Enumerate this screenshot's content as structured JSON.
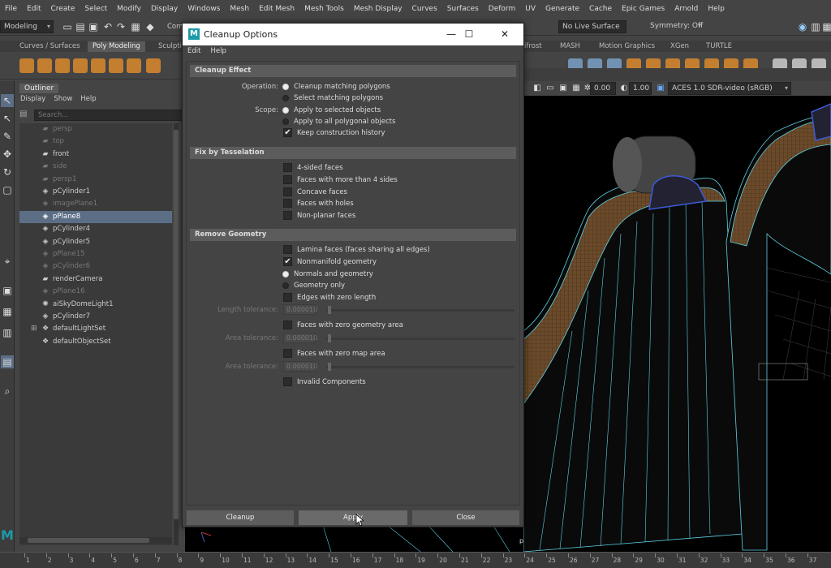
{
  "menubar": {
    "items": [
      "File",
      "Edit",
      "Create",
      "Select",
      "Modify",
      "Display",
      "Windows",
      "Mesh",
      "Edit Mesh",
      "Mesh Tools",
      "Mesh Display",
      "Curves",
      "Surfaces",
      "Deform",
      "UV",
      "Generate",
      "Cache",
      "Epic Games",
      "Arnold",
      "Help"
    ]
  },
  "status_line": {
    "mode": "Modeling",
    "component_label": "Com",
    "live_surface": "No Live Surface",
    "symmetry": "Symmetry: Off"
  },
  "shelf": {
    "tabs": [
      "Curves / Surfaces",
      "Poly Modeling",
      "Sculptin",
      "ifrost",
      "MASH",
      "Motion Graphics",
      "XGen",
      "TURTLE"
    ],
    "active_tab": "Poly Modeling"
  },
  "outliner": {
    "title": "Outliner",
    "menus": [
      "Display",
      "Show",
      "Help"
    ],
    "search_placeholder": "Search...",
    "rows": [
      {
        "label": "persp",
        "icon": "camera-icon",
        "dim": true
      },
      {
        "label": "top",
        "icon": "camera-icon",
        "dim": true
      },
      {
        "label": "front",
        "icon": "camera-icon",
        "dim": false
      },
      {
        "label": "side",
        "icon": "camera-icon",
        "dim": true
      },
      {
        "label": "persp1",
        "icon": "camera-icon",
        "dim": true
      },
      {
        "label": "pCylinder1",
        "icon": "mesh-icon",
        "dim": false
      },
      {
        "label": "imagePlane1",
        "icon": "mesh-icon",
        "dim": true
      },
      {
        "label": "pPlane8",
        "icon": "mesh-icon",
        "dim": false,
        "selected": true
      },
      {
        "label": "pCylinder4",
        "icon": "mesh-icon",
        "dim": false
      },
      {
        "label": "pCylinder5",
        "icon": "mesh-icon",
        "dim": false
      },
      {
        "label": "pPlane15",
        "icon": "mesh-icon",
        "dim": true
      },
      {
        "label": "pCylinder6",
        "icon": "mesh-icon",
        "dim": true
      },
      {
        "label": "renderCamera",
        "icon": "camera-icon",
        "dim": false
      },
      {
        "label": "pPlane16",
        "icon": "mesh-icon",
        "dim": true
      },
      {
        "label": "aiSkyDomeLight1",
        "icon": "light-icon",
        "dim": false
      },
      {
        "label": "pCylinder7",
        "icon": "mesh-icon",
        "dim": false
      },
      {
        "label": "defaultLightSet",
        "icon": "set-icon",
        "dim": false,
        "expandable": true
      },
      {
        "label": "defaultObjectSet",
        "icon": "set-icon",
        "dim": false
      }
    ]
  },
  "viewport": {
    "near_value": "0.00",
    "far_value": "1.00",
    "color_space": "ACES 1.0 SDR-video (sRGB)",
    "camera_label": "persp"
  },
  "dialog": {
    "title": "Cleanup Options",
    "logo_letter": "M",
    "menus": [
      "Edit",
      "Help"
    ],
    "sections": {
      "cleanup_effect": "Cleanup Effect",
      "fix_by_tesselation": "Fix by Tesselation",
      "remove_geometry": "Remove Geometry"
    },
    "operation_label": "Operation:",
    "operation_options": [
      "Cleanup matching polygons",
      "Select matching polygons"
    ],
    "scope_label": "Scope:",
    "scope_options": [
      "Apply to selected objects",
      "Apply to all polygonal objects"
    ],
    "keep_history": "Keep construction history",
    "tesselation_options": [
      "4-sided faces",
      "Faces with more than 4 sides",
      "Concave faces",
      "Faces with holes",
      "Non-planar faces"
    ],
    "lamina": "Lamina faces (faces sharing all edges)",
    "nonmanifold": "Nonmanifold geometry",
    "normals_and_geometry": "Normals and geometry",
    "geometry_only": "Geometry only",
    "edges_zero_length": "Edges with zero length",
    "length_tolerance_label": "Length tolerance:",
    "length_tolerance_value": "0.000010",
    "faces_zero_geometry": "Faces with zero geometry area",
    "area_tolerance_label": "Area tolerance:",
    "area_tolerance_value": "0.000010",
    "faces_zero_map": "Faces with zero map area",
    "area_tolerance2_label": "Area tolerance:",
    "area_tolerance2_value": "0.000010",
    "invalid_components": "Invalid Components",
    "buttons": {
      "cleanup": "Cleanup",
      "apply": "Apply",
      "close": "Close"
    }
  },
  "timeline": {
    "ticks": [
      "1",
      "2",
      "3",
      "4",
      "5",
      "6",
      "7",
      "8",
      "9",
      "10",
      "11",
      "12",
      "13",
      "14",
      "15",
      "16",
      "17",
      "18",
      "19",
      "20",
      "21",
      "22",
      "23",
      "24",
      "25",
      "26",
      "27",
      "28",
      "29",
      "30",
      "31",
      "32",
      "33",
      "34",
      "35",
      "36",
      "37"
    ]
  },
  "colors": {
    "selection": "#5b6e86",
    "maya_teal": "#1b9aa8",
    "wire_cyan": "#5fd3e6",
    "surface_brown": "#6b4a2a"
  }
}
